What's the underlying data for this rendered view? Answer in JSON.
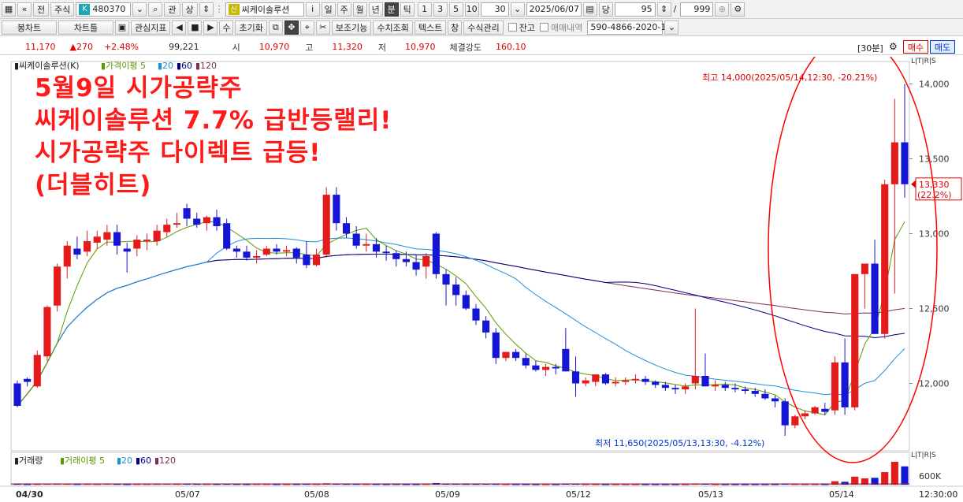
{
  "toolbar1": {
    "left_icon": "grid-icon",
    "up_icon": "double-up-icon",
    "jeon": "전",
    "market": "주식",
    "k_badge": "K",
    "code": "480370",
    "gwan": "관",
    "sang": "상",
    "sh_badge": "신",
    "stock_name": "씨케이솔루션",
    "info": "i",
    "periods": [
      "일",
      "주",
      "월",
      "년",
      "분",
      "틱"
    ],
    "active_period": "분",
    "intervals": [
      "1",
      "3",
      "5",
      "10"
    ],
    "interval_value": "30",
    "date": "2025/06/07",
    "dang": "당",
    "count": "95",
    "slash": "/",
    "total": "999"
  },
  "toolbar2": {
    "buttons": [
      "봉차트",
      "차트틀",
      "관심지표",
      "수",
      "초기화",
      "보조기능",
      "수치조회",
      "텍스트",
      "창",
      "수식관리"
    ],
    "jango": "잔고",
    "trade_history": "매매내역",
    "account": "590-4866-2020-1"
  },
  "price_bar": {
    "price": "11,170",
    "change": "▲270",
    "change_pct": "+2.48%",
    "volume": "99,221",
    "open_label": "시",
    "open": "10,970",
    "high_label": "고",
    "high": "11,320",
    "low_label": "저",
    "low": "10,970",
    "strength_label": "체결강도",
    "strength": "160.10",
    "period_tag": "[30분]",
    "buy": "매수",
    "sell": "매도"
  },
  "headline": "5월9일 시가공략주\n씨케이솔루션 7.7% 급반등랠리!\n시가공략주 다이렉트 급등!\n(더블히트)",
  "chart_data": {
    "type": "candlestick",
    "title": "씨케이솔루션(K)",
    "legend": [
      {
        "name": "가격이평 5",
        "color": "#5a9a00"
      },
      {
        "name": "20",
        "color": "#1f8fd6"
      },
      {
        "name": "60",
        "color": "#000080"
      },
      {
        "name": "120",
        "color": "#7a2e55"
      }
    ],
    "volume_legend": [
      "거래량",
      "거래이평 5",
      "20",
      "60",
      "120"
    ],
    "ylim": [
      11550,
      14150
    ],
    "y_ticks": [
      "14,000",
      "13,500",
      "13,000",
      "12,500",
      "12,000"
    ],
    "y_tick_values": [
      14000,
      13500,
      13000,
      12500,
      12000
    ],
    "x_labels": [
      "04/30",
      "05/07",
      "05/08",
      "05/09",
      "05/12",
      "05/13",
      "05/14",
      "12:30:00"
    ],
    "annotations": {
      "max": "최고 14,000(2025/05/14,12:30, -20.21%)",
      "min": "최저 11,650(2025/05/13,13:30, -4.12%)"
    },
    "current_price": "13,330",
    "current_pct": "(22.2%)",
    "volume_tick": "600K",
    "scale_tag": "L|T|R|S",
    "colors": {
      "up": "#e41b1b",
      "down": "#1515d6",
      "ma5": "#5a9a00",
      "ma20": "#1f8fd6",
      "ma60": "#000080",
      "ma120": "#7a2e55"
    },
    "candles": [
      [
        12000,
        12020,
        11840,
        11850
      ],
      [
        12030,
        12040,
        11980,
        12010
      ],
      [
        11980,
        12220,
        11970,
        12190
      ],
      [
        12180,
        12520,
        12150,
        12510
      ],
      [
        12520,
        12800,
        12480,
        12780
      ],
      [
        12780,
        12950,
        12700,
        12920
      ],
      [
        12900,
        12980,
        12830,
        12860
      ],
      [
        12880,
        13020,
        12850,
        12950
      ],
      [
        12940,
        13020,
        12900,
        12980
      ],
      [
        12960,
        13060,
        12920,
        13010
      ],
      [
        13010,
        13060,
        12860,
        12920
      ],
      [
        12900,
        12940,
        12740,
        12880
      ],
      [
        12900,
        12990,
        12850,
        12960
      ],
      [
        12950,
        13000,
        12890,
        12960
      ],
      [
        12950,
        13060,
        12920,
        13020
      ],
      [
        13010,
        13100,
        12980,
        13060
      ],
      [
        13060,
        13140,
        13040,
        13070
      ],
      [
        13170,
        13200,
        13050,
        13100
      ],
      [
        13100,
        13140,
        13040,
        13060
      ],
      [
        13070,
        13120,
        13020,
        13110
      ],
      [
        13110,
        13160,
        13020,
        13050
      ],
      [
        13070,
        13100,
        12890,
        12900
      ],
      [
        12900,
        12920,
        12840,
        12880
      ],
      [
        12880,
        12920,
        12820,
        12840
      ],
      [
        12840,
        12890,
        12800,
        12850
      ],
      [
        12860,
        12920,
        12850,
        12900
      ],
      [
        12900,
        12930,
        12860,
        12880
      ],
      [
        12880,
        12920,
        12850,
        12890
      ],
      [
        12900,
        12910,
        12800,
        12840
      ],
      [
        12860,
        12950,
        12770,
        12790
      ],
      [
        12790,
        12900,
        12780,
        12860
      ],
      [
        12860,
        13310,
        12840,
        13260
      ],
      [
        13260,
        13310,
        13020,
        13070
      ],
      [
        13070,
        13110,
        12970,
        13000
      ],
      [
        13000,
        13050,
        12900,
        12920
      ],
      [
        12920,
        13000,
        12880,
        12930
      ],
      [
        12930,
        12970,
        12840,
        12880
      ],
      [
        12880,
        12920,
        12820,
        12870
      ],
      [
        12870,
        12890,
        12780,
        12830
      ],
      [
        12830,
        12880,
        12780,
        12810
      ],
      [
        12810,
        12860,
        12720,
        12760
      ],
      [
        12780,
        12870,
        12700,
        12850
      ],
      [
        13000,
        13010,
        12700,
        12730
      ],
      [
        12730,
        12760,
        12520,
        12660
      ],
      [
        12660,
        12710,
        12520,
        12590
      ],
      [
        12590,
        12620,
        12490,
        12500
      ],
      [
        12500,
        12530,
        12390,
        12420
      ],
      [
        12420,
        12450,
        12300,
        12340
      ],
      [
        12340,
        12370,
        12130,
        12170
      ],
      [
        12170,
        12210,
        12150,
        12210
      ],
      [
        12210,
        12230,
        12150,
        12170
      ],
      [
        12170,
        12200,
        12100,
        12120
      ],
      [
        12120,
        12150,
        12080,
        12090
      ],
      [
        12090,
        12130,
        12050,
        12110
      ],
      [
        12110,
        12130,
        12060,
        12100
      ],
      [
        12230,
        12370,
        12080,
        12080
      ],
      [
        12080,
        12180,
        11910,
        12000
      ],
      [
        12000,
        12040,
        11980,
        12020
      ],
      [
        12010,
        12060,
        11980,
        12060
      ],
      [
        12060,
        12070,
        11990,
        12000
      ],
      [
        12000,
        12040,
        11980,
        12010
      ],
      [
        12010,
        12040,
        11990,
        12020
      ],
      [
        12020,
        12060,
        12000,
        12030
      ],
      [
        12030,
        12050,
        11990,
        12010
      ],
      [
        12010,
        12020,
        11970,
        11990
      ],
      [
        11990,
        12010,
        11950,
        11970
      ],
      [
        11970,
        11990,
        11930,
        11960
      ],
      [
        11960,
        12000,
        11930,
        11980
      ],
      [
        12000,
        12500,
        11960,
        12050
      ],
      [
        12050,
        12200,
        11980,
        11980
      ],
      [
        11980,
        12020,
        11950,
        11990
      ],
      [
        11990,
        12010,
        11950,
        11970
      ],
      [
        11970,
        12000,
        11940,
        11960
      ],
      [
        11960,
        11980,
        11930,
        11950
      ],
      [
        11950,
        11970,
        11910,
        11930
      ],
      [
        11930,
        11960,
        11890,
        11900
      ],
      [
        11900,
        11920,
        11840,
        11880
      ],
      [
        11880,
        11900,
        11650,
        11720
      ],
      [
        11720,
        11790,
        11700,
        11780
      ],
      [
        11780,
        11820,
        11760,
        11800
      ],
      [
        11800,
        11850,
        11790,
        11840
      ],
      [
        11830,
        11870,
        11790,
        11810
      ],
      [
        11820,
        12180,
        11790,
        12140
      ],
      [
        12140,
        12300,
        11790,
        11840
      ],
      [
        11840,
        12350,
        11820,
        12730
      ],
      [
        12730,
        12800,
        12500,
        12800
      ],
      [
        12800,
        12960,
        12330,
        12330
      ],
      [
        12330,
        13360,
        12300,
        13330
      ],
      [
        13330,
        13900,
        12600,
        13610
      ],
      [
        13610,
        14000,
        13240,
        13330
      ]
    ],
    "volumes": [
      6,
      4,
      5,
      8,
      10,
      9,
      5,
      6,
      5,
      7,
      6,
      4,
      5,
      5,
      6,
      7,
      6,
      9,
      6,
      5,
      5,
      6,
      5,
      4,
      5,
      5,
      4,
      4,
      5,
      6,
      5,
      12,
      8,
      6,
      6,
      5,
      5,
      4,
      5,
      4,
      4,
      5,
      14,
      9,
      7,
      6,
      6,
      7,
      6,
      4,
      4,
      4,
      3,
      3,
      3,
      8,
      7,
      4,
      4,
      3,
      3,
      3,
      3,
      3,
      3,
      3,
      3,
      3,
      10,
      7,
      3,
      3,
      3,
      3,
      3,
      3,
      4,
      9,
      5,
      4,
      4,
      4,
      30,
      25,
      70,
      55,
      60,
      110,
      200,
      160
    ]
  }
}
